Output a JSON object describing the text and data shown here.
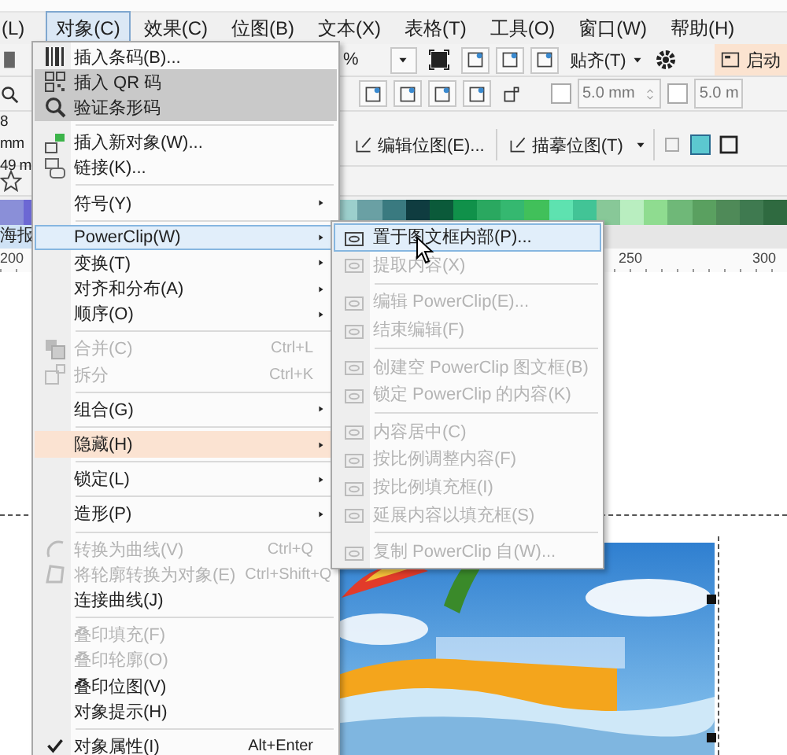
{
  "menu_bar": [
    {
      "label": "(L)",
      "selected": false
    },
    {
      "label": "对象(C)",
      "selected": true
    },
    {
      "label": "效果(C)",
      "selected": false
    },
    {
      "label": "位图(B)",
      "selected": false
    },
    {
      "label": "文本(X)",
      "selected": false
    },
    {
      "label": "表格(T)",
      "selected": false
    },
    {
      "label": "工具(O)",
      "selected": false
    },
    {
      "label": "窗口(W)",
      "selected": false
    },
    {
      "label": "帮助(H)",
      "selected": false
    }
  ],
  "toolbar": {
    "zoom_suffix": "%",
    "snap": "贴齐(T)",
    "launch": "启动"
  },
  "property_bar": {
    "left_values": [
      "8 mm",
      "49 m"
    ],
    "nudge_1": "5.0 mm",
    "nudge_1_checked": false,
    "nudge_2": "5.0 m",
    "nudge_2_checked": false,
    "edit_bitmap": "编辑位图(E)...",
    "trace_bitmap": "描摹位图(T)"
  },
  "document_tab": "海报",
  "ruler_labels": [
    "200",
    "250",
    "300"
  ],
  "object_menu": [
    {
      "kind": "item",
      "label": "插入条码(B)...",
      "selected": false,
      "hovered": false,
      "shaded": false,
      "disabled": false,
      "submenu": false,
      "checked": false
    },
    {
      "kind": "item",
      "label": "插入 QR 码",
      "selected": false,
      "hovered": false,
      "shaded": true,
      "disabled": false,
      "submenu": false,
      "checked": false
    },
    {
      "kind": "item",
      "label": "验证条形码",
      "selected": false,
      "hovered": false,
      "shaded": true,
      "disabled": false,
      "submenu": false,
      "checked": false
    },
    {
      "kind": "separator"
    },
    {
      "kind": "item",
      "label": "插入新对象(W)...",
      "selected": false,
      "hovered": false,
      "shaded": false,
      "disabled": false,
      "submenu": false,
      "checked": false
    },
    {
      "kind": "item",
      "label": "链接(K)...",
      "selected": false,
      "hovered": false,
      "shaded": false,
      "disabled": false,
      "submenu": false,
      "checked": false
    },
    {
      "kind": "separator"
    },
    {
      "kind": "item",
      "label": "符号(Y)",
      "selected": false,
      "hovered": false,
      "shaded": false,
      "disabled": false,
      "submenu": true,
      "checked": false
    },
    {
      "kind": "separator"
    },
    {
      "kind": "item",
      "label": "PowerClip(W)",
      "selected": true,
      "hovered": false,
      "shaded": false,
      "disabled": false,
      "submenu": true,
      "checked": false
    },
    {
      "kind": "item",
      "label": "变换(T)",
      "selected": false,
      "hovered": false,
      "shaded": false,
      "disabled": false,
      "submenu": true,
      "checked": false
    },
    {
      "kind": "item",
      "label": "对齐和分布(A)",
      "selected": false,
      "hovered": false,
      "shaded": false,
      "disabled": false,
      "submenu": true,
      "checked": false
    },
    {
      "kind": "item",
      "label": "顺序(O)",
      "selected": false,
      "hovered": false,
      "shaded": false,
      "disabled": false,
      "submenu": true,
      "checked": false
    },
    {
      "kind": "separator"
    },
    {
      "kind": "item",
      "label": "合并(C)",
      "shortcut": "Ctrl+L",
      "selected": false,
      "hovered": false,
      "shaded": false,
      "disabled": true,
      "submenu": false,
      "checked": false
    },
    {
      "kind": "item",
      "label": "拆分",
      "shortcut": "Ctrl+K",
      "selected": false,
      "hovered": false,
      "shaded": false,
      "disabled": true,
      "submenu": false,
      "checked": false
    },
    {
      "kind": "separator"
    },
    {
      "kind": "item",
      "label": "组合(G)",
      "selected": false,
      "hovered": false,
      "shaded": false,
      "disabled": false,
      "submenu": true,
      "checked": false
    },
    {
      "kind": "separator"
    },
    {
      "kind": "item",
      "label": "隐藏(H)",
      "selected": false,
      "hovered": true,
      "shaded": false,
      "disabled": false,
      "submenu": true,
      "checked": false
    },
    {
      "kind": "separator"
    },
    {
      "kind": "item",
      "label": "锁定(L)",
      "selected": false,
      "hovered": false,
      "shaded": false,
      "disabled": false,
      "submenu": true,
      "checked": false
    },
    {
      "kind": "separator"
    },
    {
      "kind": "item",
      "label": "造形(P)",
      "selected": false,
      "hovered": false,
      "shaded": false,
      "disabled": false,
      "submenu": true,
      "checked": false
    },
    {
      "kind": "separator"
    },
    {
      "kind": "item",
      "label": "转换为曲线(V)",
      "shortcut": "Ctrl+Q",
      "selected": false,
      "hovered": false,
      "shaded": false,
      "disabled": true,
      "submenu": false,
      "checked": false
    },
    {
      "kind": "item",
      "label": "将轮廓转换为对象(E)",
      "shortcut": "Ctrl+Shift+Q",
      "selected": false,
      "hovered": false,
      "shaded": false,
      "disabled": true,
      "submenu": false,
      "checked": false
    },
    {
      "kind": "item",
      "label": "连接曲线(J)",
      "selected": false,
      "hovered": false,
      "shaded": false,
      "disabled": false,
      "submenu": false,
      "checked": false
    },
    {
      "kind": "separator"
    },
    {
      "kind": "item",
      "label": "叠印填充(F)",
      "selected": false,
      "hovered": false,
      "shaded": false,
      "disabled": true,
      "submenu": false,
      "checked": false
    },
    {
      "kind": "item",
      "label": "叠印轮廓(O)",
      "selected": false,
      "hovered": false,
      "shaded": false,
      "disabled": true,
      "submenu": false,
      "checked": false
    },
    {
      "kind": "item",
      "label": "叠印位图(V)",
      "selected": false,
      "hovered": false,
      "shaded": false,
      "disabled": false,
      "submenu": false,
      "checked": false
    },
    {
      "kind": "item",
      "label": "对象提示(H)",
      "selected": false,
      "hovered": false,
      "shaded": false,
      "disabled": false,
      "submenu": false,
      "checked": false
    },
    {
      "kind": "separator"
    },
    {
      "kind": "item",
      "label": "对象属性(I)",
      "shortcut": "Alt+Enter",
      "selected": false,
      "hovered": false,
      "shaded": false,
      "disabled": false,
      "submenu": false,
      "checked": true
    }
  ],
  "powerclip_menu": [
    {
      "kind": "item",
      "label": "置于图文框内部(P)...",
      "selected": true,
      "disabled": false
    },
    {
      "kind": "item",
      "label": "提取内容(X)",
      "selected": false,
      "disabled": true
    },
    {
      "kind": "separator"
    },
    {
      "kind": "item",
      "label": "编辑 PowerClip(E)...",
      "selected": false,
      "disabled": true
    },
    {
      "kind": "item",
      "label": "结束编辑(F)",
      "selected": false,
      "disabled": true
    },
    {
      "kind": "separator"
    },
    {
      "kind": "item",
      "label": "创建空 PowerClip 图文框(B)",
      "selected": false,
      "disabled": true
    },
    {
      "kind": "item",
      "label": "锁定 PowerClip 的内容(K)",
      "selected": false,
      "disabled": true
    },
    {
      "kind": "separator"
    },
    {
      "kind": "item",
      "label": "内容居中(C)",
      "selected": false,
      "disabled": true
    },
    {
      "kind": "item",
      "label": "按比例调整内容(F)",
      "selected": false,
      "disabled": true
    },
    {
      "kind": "item",
      "label": "按比例填充框(I)",
      "selected": false,
      "disabled": true
    },
    {
      "kind": "item",
      "label": "延展内容以填充框(S)",
      "selected": false,
      "disabled": true
    },
    {
      "kind": "separator"
    },
    {
      "kind": "item",
      "label": "复制 PowerClip 自(W)...",
      "selected": false,
      "disabled": true
    }
  ]
}
